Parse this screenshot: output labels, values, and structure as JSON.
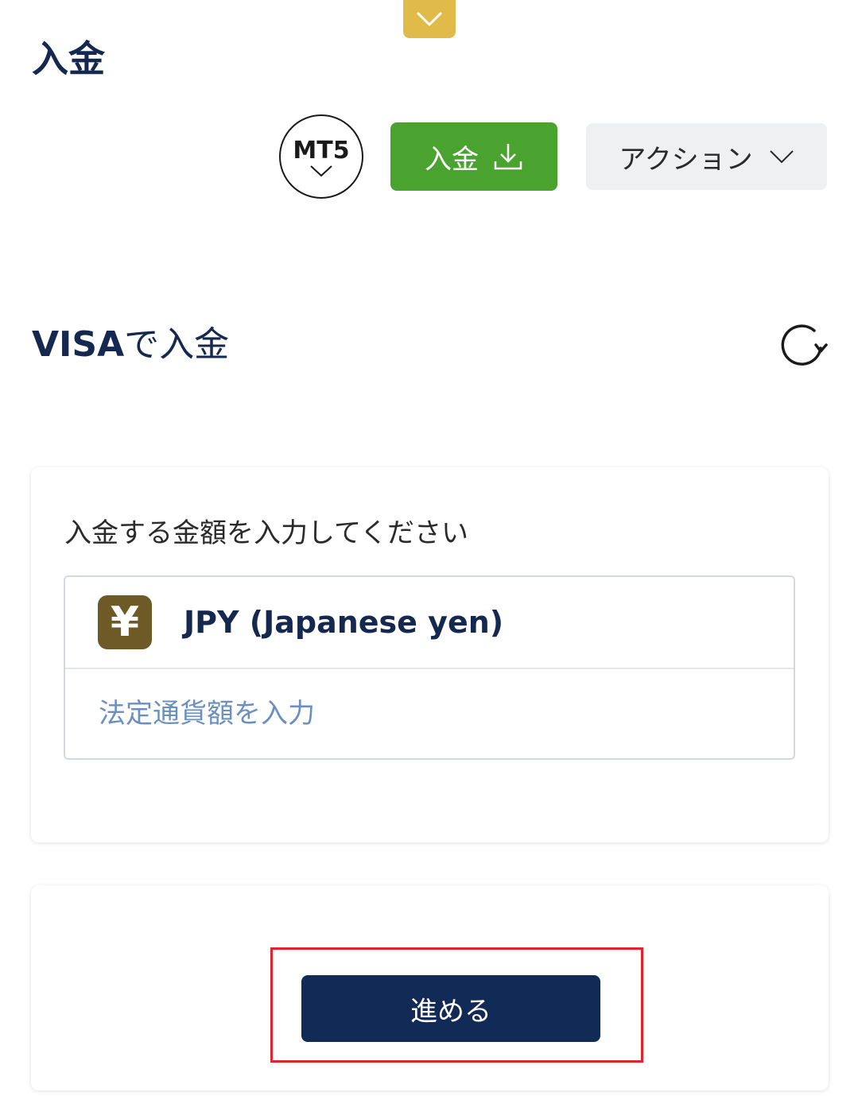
{
  "page": {
    "title": "入金"
  },
  "header": {
    "account_badge": "MT5",
    "deposit_button_label": "入金",
    "action_button_label": "アクション"
  },
  "section": {
    "title_visa": "VISA",
    "title_rest": "で入金"
  },
  "amount_card": {
    "instruction": "入金する金額を入力してください",
    "currency_symbol": "¥",
    "currency_name": "JPY (Japanese yen)",
    "fiat_placeholder": "法定通貨額を入力"
  },
  "actions": {
    "proceed_label": "進める"
  },
  "colors": {
    "brand_navy": "#142850",
    "deposit_green": "#4aa22f",
    "tab_gold": "#e0bb4a",
    "yen_brown": "#6e5a26",
    "highlight_red": "#e0242a"
  },
  "icons": {
    "top_tab": "chevron-down-icon",
    "account_badge": "chevron-down-icon",
    "deposit": "download-icon",
    "action": "chevron-down-icon",
    "refresh": "refresh-icon",
    "currency": "yen-icon"
  }
}
